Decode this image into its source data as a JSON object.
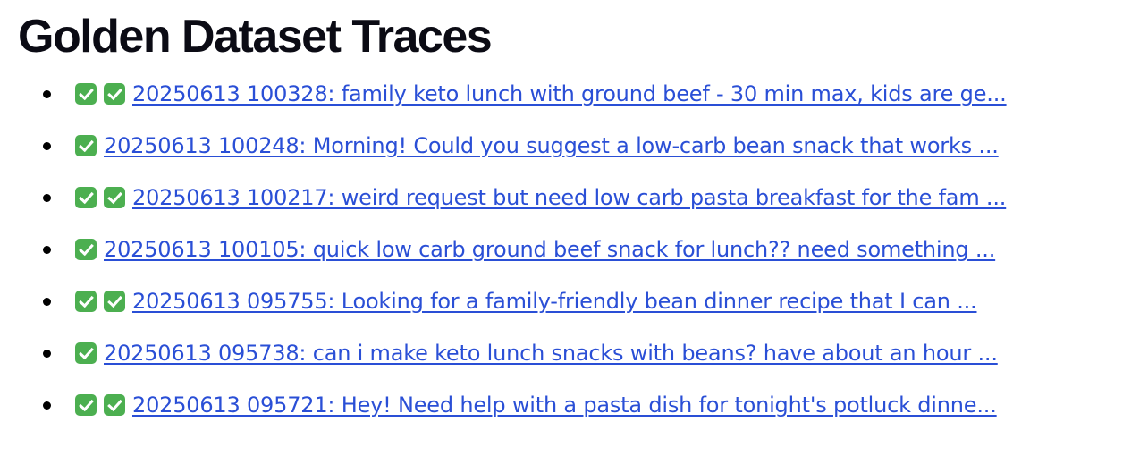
{
  "page": {
    "title": "Golden Dataset Traces"
  },
  "traces": [
    {
      "checks": 2,
      "label": "20250613 100328: family keto lunch with ground beef - 30 min max, kids are ge..."
    },
    {
      "checks": 1,
      "label": "20250613 100248: Morning! Could you suggest a low-carb bean snack that works ..."
    },
    {
      "checks": 2,
      "label": "20250613 100217: weird request but need low carb pasta breakfast for the fam ..."
    },
    {
      "checks": 1,
      "label": "20250613 100105: quick low carb ground beef snack for lunch?? need something ..."
    },
    {
      "checks": 2,
      "label": "20250613 095755: Looking for a family-friendly bean dinner recipe that I can ..."
    },
    {
      "checks": 1,
      "label": "20250613 095738: can i make keto lunch snacks with beans? have about an hour ..."
    },
    {
      "checks": 2,
      "label": "20250613 095721: Hey! Need help with a pasta dish for tonight's potluck dinne..."
    }
  ],
  "icons": {
    "check": "check-mark-button-icon"
  },
  "colors": {
    "link": "#2a4fd6",
    "check_bg": "#4caf50",
    "heading": "#0b0b14"
  }
}
